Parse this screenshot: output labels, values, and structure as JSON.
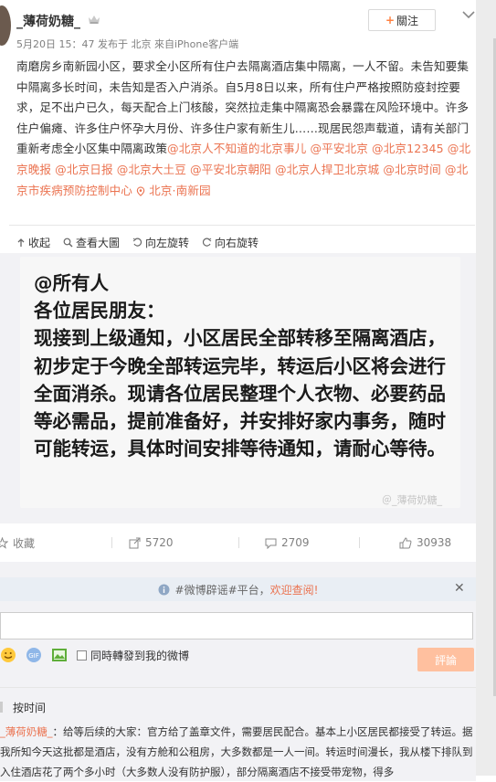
{
  "post": {
    "author": "_薄荷奶糖_",
    "follow_label": "關注",
    "meta": "5月20日 15：47 发布于 北京 來自iPhone客户端",
    "body_text": "南磨房乡南新园小区，要求全小区所有住户去隔离酒店集中隔离，一人不留。未告知要集中隔离多长时间，未告知是否入户消杀。自5月8日以来，所有住户严格按照防疫封控要求，足不出户已久，每天配合上门核酸，突然拉走集中隔离恐会暴露在风险环境中。许多住户偏瘫、许多住户怀孕大月份、许多住户家有新生儿……现居民怨声载道，请有关部门重新考虑全小区集中隔离政策",
    "mentions": "@北京人不知道的北京事儿 @平安北京 @北京12345 @北京晚报 @北京日报 @北京大土豆 @平安北京朝阳 @北京人捍卫北京城 @北京时间 @北京市疾病预防控制中心",
    "location": "北京·南新园"
  },
  "image_toolbar": {
    "collapse": "收起",
    "view_large": "查看大圖",
    "rotate_left": "向左旋转",
    "rotate_right": "向右旋转"
  },
  "notice": {
    "line1": "@所有人",
    "line2": "各位居民朋友：",
    "body": "现接到上级通知，小区居民全部转移至隔离酒店，初步定于今晚全部转运完毕，转运后小区将会进行全面消杀。现请各位居民整理个人衣物、必要药品等必需品，提前准备好，并安排好家内事务，随时可能转运，具体时间安排等待通知，请耐心等待。",
    "watermark": "＠_薄荷奶糖_"
  },
  "actions": {
    "favorite": "收藏",
    "repost_count": "5720",
    "comment_count": "2709",
    "like_count": "30938"
  },
  "tip": {
    "prefix": "#微博辟谣#平台，",
    "highlight": "欢迎查阅!"
  },
  "comment_box": {
    "repost_checkbox_label": "同時轉發到我的微博",
    "submit_label": "評論"
  },
  "sort_label": "按时间",
  "first_comment": {
    "author": "_薄荷奶糖_",
    "text": "：给等后续的大家：官方给了盖章文件，需要居民配合。基本上小区居民都接受了转运。据我所知今天这批都是酒店，没有方舱和公租房，大多数都是一人一间。转运时间漫长，我从楼下排队到入住酒店花了两个多小时（大多数人没有防护服），部分隔离酒店不接受带宠物，得多"
  },
  "colors": {
    "accent": "#eb7350",
    "submit_bg": "#ffc09f",
    "tip_bg": "#e9eef4",
    "band_bg": "#f2f2f5"
  }
}
